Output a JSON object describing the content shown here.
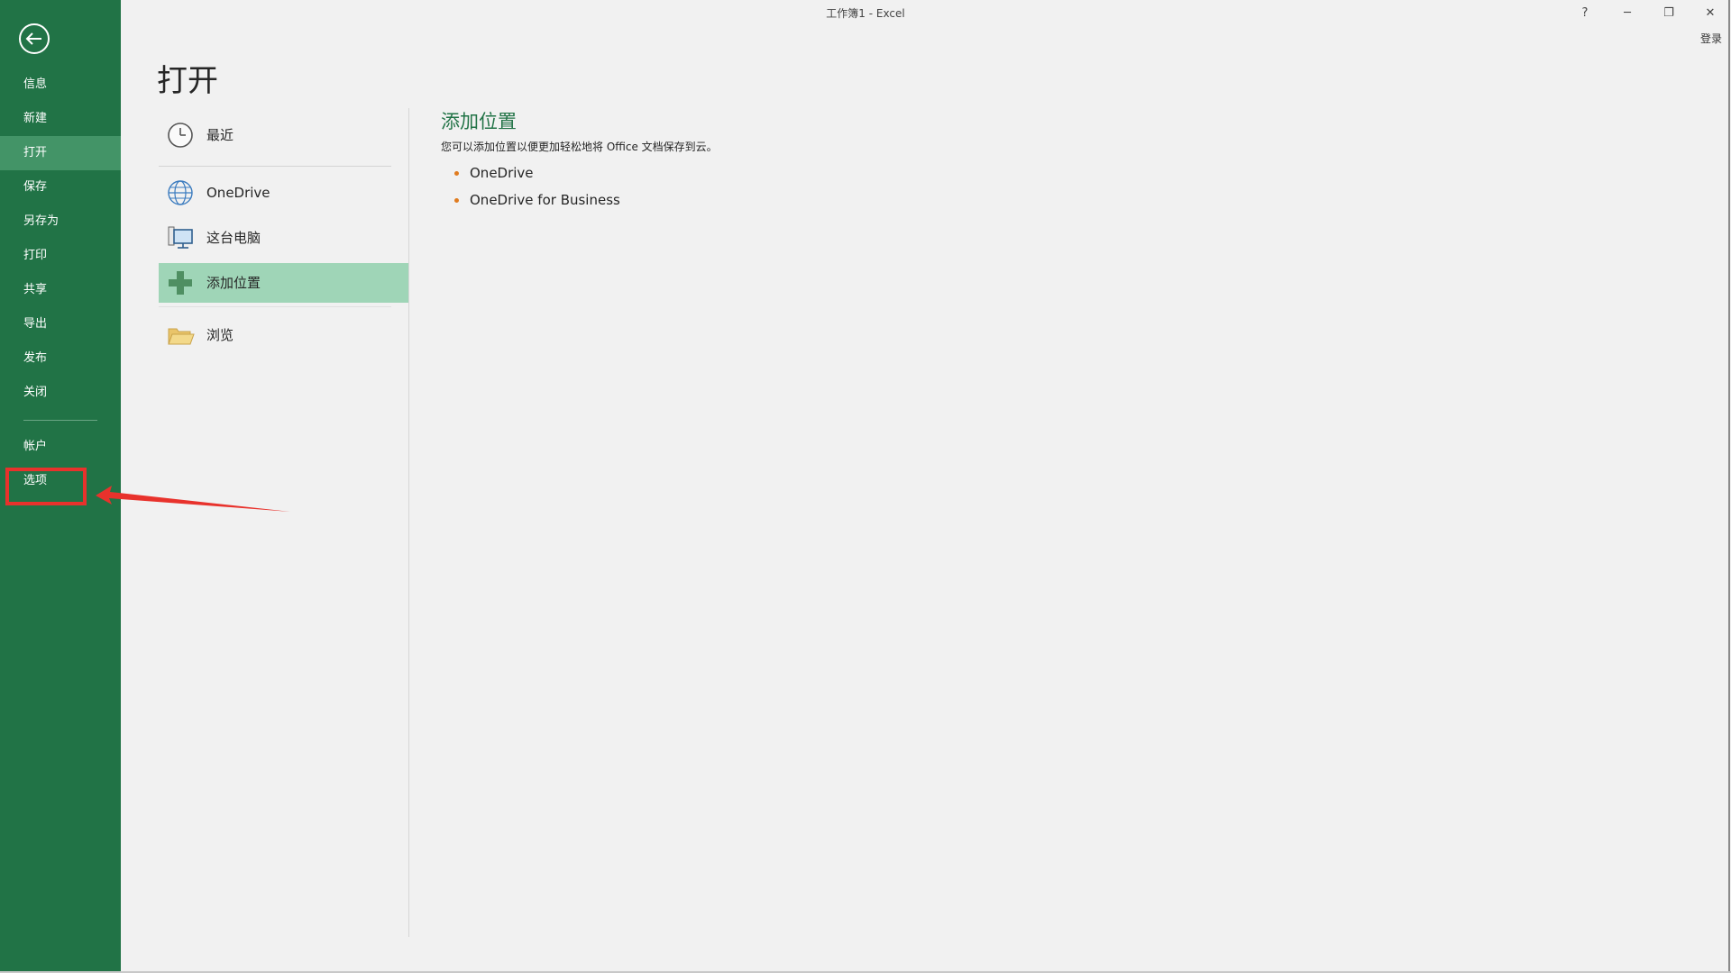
{
  "window": {
    "title": "工作簿1 - Excel",
    "help": "?",
    "minimize": "─",
    "restore": "❐",
    "close": "✕",
    "sign_in": "登录"
  },
  "sidebar": {
    "back_icon": "back-arrow-icon",
    "items": [
      {
        "label": "信息"
      },
      {
        "label": "新建"
      },
      {
        "label": "打开",
        "active": true
      },
      {
        "label": "保存"
      },
      {
        "label": "另存为"
      },
      {
        "label": "打印"
      },
      {
        "label": "共享"
      },
      {
        "label": "导出"
      },
      {
        "label": "发布"
      },
      {
        "label": "关闭"
      },
      {
        "label": "帐户"
      },
      {
        "label": "选项"
      }
    ]
  },
  "main": {
    "title": "打开",
    "places": [
      {
        "label": "最近",
        "icon": "clock-icon"
      },
      {
        "label": "OneDrive",
        "icon": "globe-icon"
      },
      {
        "label": "这台电脑",
        "icon": "computer-icon"
      },
      {
        "label": "添加位置",
        "icon": "plus-icon",
        "selected": true
      },
      {
        "label": "浏览",
        "icon": "folder-icon"
      }
    ],
    "detail": {
      "title": "添加位置",
      "description": "您可以添加位置以便更加轻松地将 Office 文档保存到云。",
      "services": [
        "OneDrive",
        "OneDrive for Business"
      ]
    }
  },
  "colors": {
    "sidebar_green": "#217346",
    "active_green": "#439467",
    "selected_place": "#9fd5b7",
    "annotation_red": "#e8322c",
    "bullet_orange": "#e07b1f"
  }
}
